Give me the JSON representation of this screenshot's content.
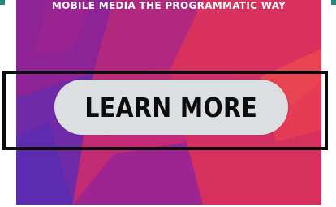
{
  "ad": {
    "tagline": "MOBILE MEDIA THE PROGRAMMATIC WAY",
    "cta_label": "LEARN MORE"
  },
  "colors": {
    "magenta": "#c22a74",
    "purple": "#7a1f9a",
    "pink": "#e23456",
    "cta_background": "#dcdfe1",
    "cta_text": "#0d0d0d",
    "outline": "#0c0c0c",
    "corner_accent": "#1f8a84"
  }
}
